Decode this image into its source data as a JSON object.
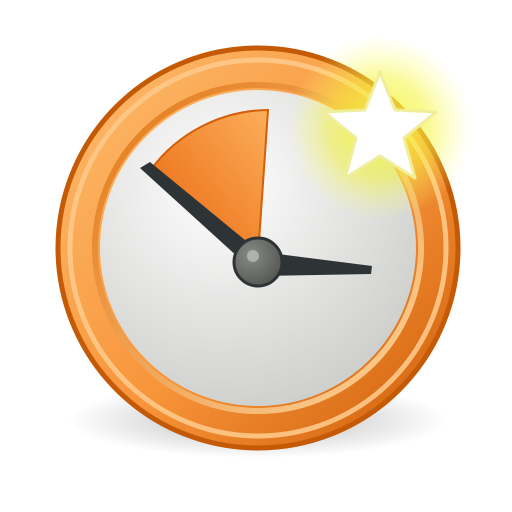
{
  "icon": {
    "name": "new-timer-icon",
    "depicts": [
      "clock",
      "elapsed-time-wedge",
      "new-star-badge"
    ],
    "colors": {
      "ring_light": "#fdbe6f",
      "ring_mid": "#f8943a",
      "ring_dark": "#cc5c07",
      "face_light": "#ffffff",
      "face_dark": "#c9cbc7",
      "wedge_light": "#fcae5a",
      "wedge_dark": "#e8650b",
      "hand": "#2e3436",
      "hub": "#555753",
      "star_fill": "#ffffff",
      "star_glow": "#f5f542"
    }
  }
}
